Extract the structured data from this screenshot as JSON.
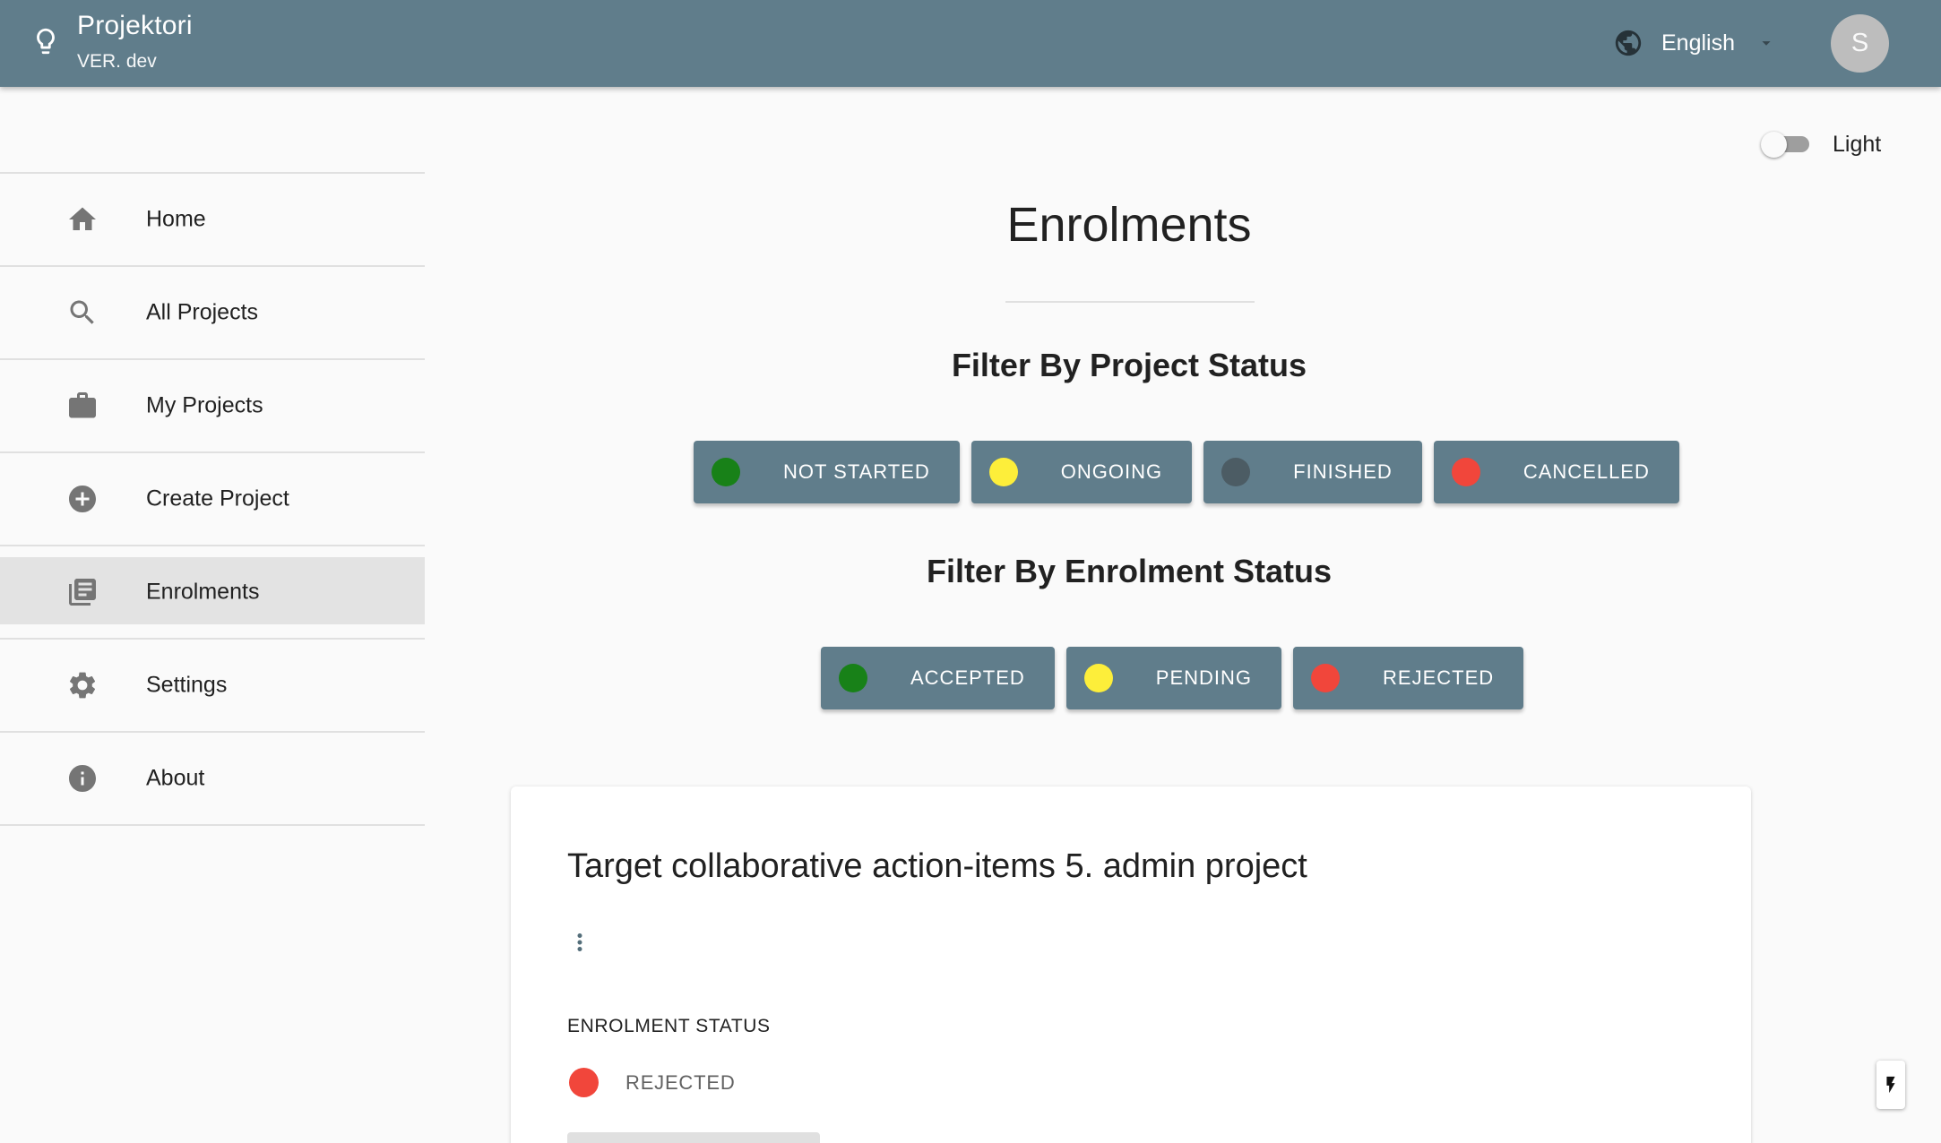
{
  "app": {
    "title": "Projektori",
    "version": "VER. dev",
    "language": "English",
    "avatar_initial": "S"
  },
  "sidebar": {
    "items": [
      {
        "label": "Home",
        "icon": "home-icon"
      },
      {
        "label": "All Projects",
        "icon": "search-icon"
      },
      {
        "label": "My Projects",
        "icon": "briefcase-icon"
      },
      {
        "label": "Create Project",
        "icon": "add-circle-icon"
      },
      {
        "label": "Enrolments",
        "icon": "list-icon",
        "active": true
      },
      {
        "label": "Settings",
        "icon": "gear-icon"
      },
      {
        "label": "About",
        "icon": "info-icon"
      }
    ]
  },
  "theme_toggle": {
    "label": "Light",
    "checked": false
  },
  "main": {
    "title": "Enrolments",
    "project_filter": {
      "heading": "Filter By Project Status",
      "chips": [
        {
          "label": "NOT STARTED",
          "color": "#188118"
        },
        {
          "label": "ONGOING",
          "color": "#fdee3a"
        },
        {
          "label": "FINISHED",
          "color": "#4c5c64"
        },
        {
          "label": "CANCELLED",
          "color": "#f1463b"
        }
      ]
    },
    "enrolment_filter": {
      "heading": "Filter By Enrolment Status",
      "chips": [
        {
          "label": "ACCEPTED",
          "color": "#188118"
        },
        {
          "label": "PENDING",
          "color": "#fdee3a"
        },
        {
          "label": "REJECTED",
          "color": "#f1463b"
        }
      ]
    },
    "card": {
      "project_name": "Target collaborative action-items 5. admin project",
      "status_heading": "ENROLMENT STATUS",
      "status": "REJECTED",
      "status_color": "#f1463b"
    }
  },
  "colors": {
    "primary": "#607d8b",
    "background": "#fafafa"
  }
}
